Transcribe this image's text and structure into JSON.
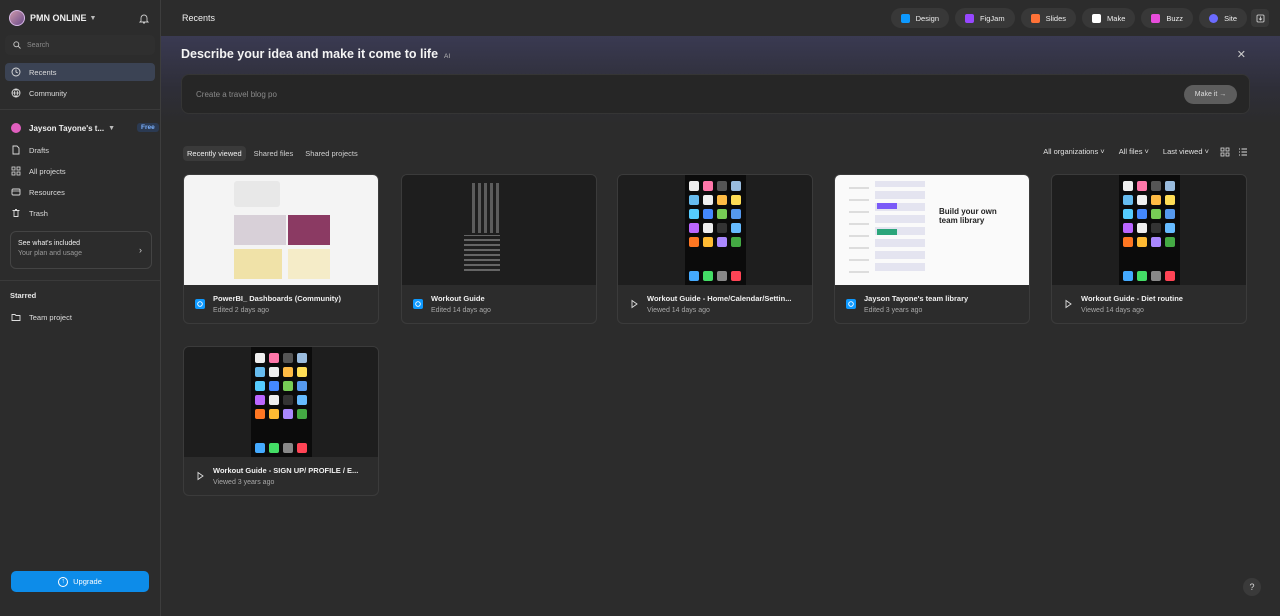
{
  "sidebar": {
    "org_name": "PMN ONLINE",
    "search_placeholder": "Search",
    "nav": [
      {
        "label": "Recents",
        "icon": "clock-icon"
      },
      {
        "label": "Community",
        "icon": "globe-icon"
      }
    ],
    "team": {
      "name": "Jayson Tayone's t...",
      "badge": "Free"
    },
    "team_nav": [
      {
        "label": "Drafts",
        "icon": "file-icon"
      },
      {
        "label": "All projects",
        "icon": "grid-icon"
      },
      {
        "label": "Resources",
        "icon": "resources-icon"
      },
      {
        "label": "Trash",
        "icon": "trash-icon"
      }
    ],
    "plan": {
      "title": "See what's included",
      "subtitle": "Your plan and usage"
    },
    "starred": {
      "heading": "Starred",
      "items": [
        {
          "label": "Team project",
          "icon": "folder-icon"
        }
      ]
    },
    "upgrade_label": "Upgrade"
  },
  "topbar": {
    "title": "Recents",
    "apps": [
      {
        "label": "Design",
        "color": "#0d99ff"
      },
      {
        "label": "FigJam",
        "color": "#9747ff"
      },
      {
        "label": "Slides",
        "color": "#ff7237"
      },
      {
        "label": "Make",
        "color": "#ffffff"
      },
      {
        "label": "Buzz",
        "color": "#e84ddc"
      },
      {
        "label": "Site",
        "color": "#6b6bff"
      }
    ]
  },
  "prompt": {
    "title": "Describe your idea and make it come to life",
    "tag": "AI",
    "placeholder": "Create a travel blog po",
    "button": "Make it →"
  },
  "tabs": [
    "Recently viewed",
    "Shared files",
    "Shared projects"
  ],
  "filters": [
    "All organizations ˅",
    "All files ˅",
    "Last viewed ˅"
  ],
  "files": [
    {
      "title": "PowerBI_ Dashboards (Community)",
      "subtitle": "Edited 2 days ago",
      "type": "design"
    },
    {
      "title": "Workout Guide",
      "subtitle": "Edited 14 days ago",
      "type": "design"
    },
    {
      "title": "Workout Guide - Home/Calendar/Settin...",
      "subtitle": "Viewed 14 days ago",
      "type": "prototype"
    },
    {
      "title": "Jayson Tayone's team library",
      "subtitle": "Edited 3 years ago",
      "type": "design"
    },
    {
      "title": "Workout Guide - Diet routine",
      "subtitle": "Viewed 14 days ago",
      "type": "prototype"
    },
    {
      "title": "Workout Guide - SIGN UP/ PROFILE / E...",
      "subtitle": "Viewed 3 years ago",
      "type": "prototype"
    }
  ],
  "library_thumb": {
    "heading": "Build your own team library"
  },
  "help_label": "?"
}
